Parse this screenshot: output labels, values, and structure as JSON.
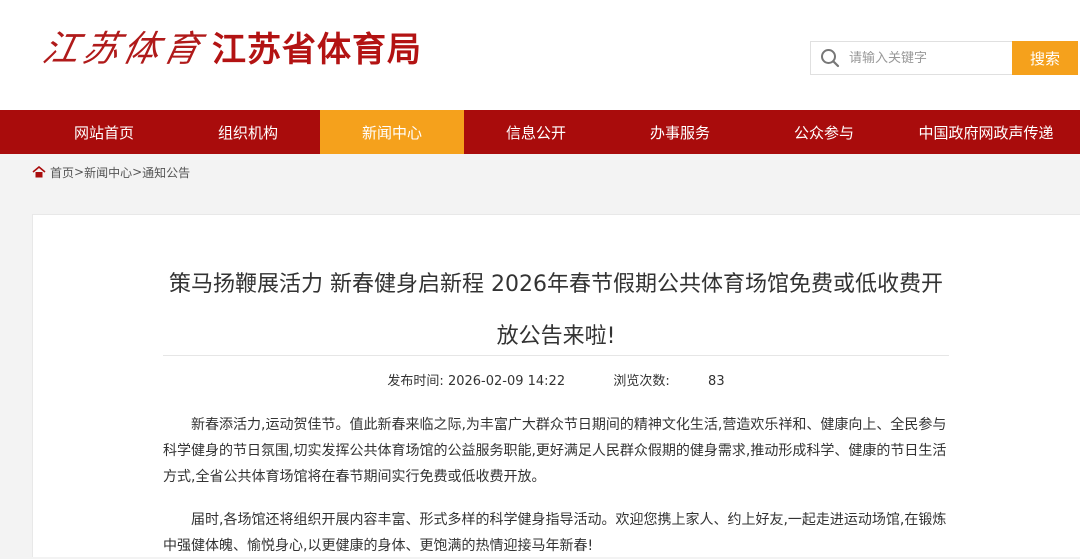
{
  "header": {
    "logo_calligraphy": "江苏体育",
    "logo_text": "江苏省体育局"
  },
  "search": {
    "placeholder": "请输入关键字",
    "button_label": "搜索"
  },
  "nav": {
    "items": [
      {
        "label": "网站首页"
      },
      {
        "label": "组织机构"
      },
      {
        "label": "新闻中心",
        "active": true
      },
      {
        "label": "信息公开"
      },
      {
        "label": "办事服务"
      },
      {
        "label": "公众参与"
      },
      {
        "label": "中国政府网政声传递"
      }
    ]
  },
  "breadcrumb": {
    "items": [
      "首页",
      "新闻中心",
      "通知公告"
    ],
    "separator": ">"
  },
  "article": {
    "title": "策马扬鞭展活力 新春健身启新程 2026年春节假期公共体育场馆免费或低收费开放公告来啦!",
    "publish_label": "发布时间:",
    "publish_time": "2026-02-09 14:22",
    "views_label": "浏览次数:",
    "views": "83",
    "paragraphs": [
      "新春添活力,运动贺佳节。值此新春来临之际,为丰富广大群众节日期间的精神文化生活,营造欢乐祥和、健康向上、全民参与科学健身的节日氛围,切实发挥公共体育场馆的公益服务职能,更好满足人民群众假期的健身需求,推动形成科学、健康的节日生活方式,全省公共体育场馆将在春节期间实行免费或低收费开放。",
      "届时,各场馆还将组织开展内容丰富、形式多样的科学健身指导活动。欢迎您携上家人、约上好友,一起走进运动场馆,在锻炼中强健体魄、愉悦身心,以更健康的身体、更饱满的热情迎接马年新春!"
    ]
  },
  "colors": {
    "brand_red": "#a90c0c",
    "accent_orange": "#f5a11c"
  }
}
